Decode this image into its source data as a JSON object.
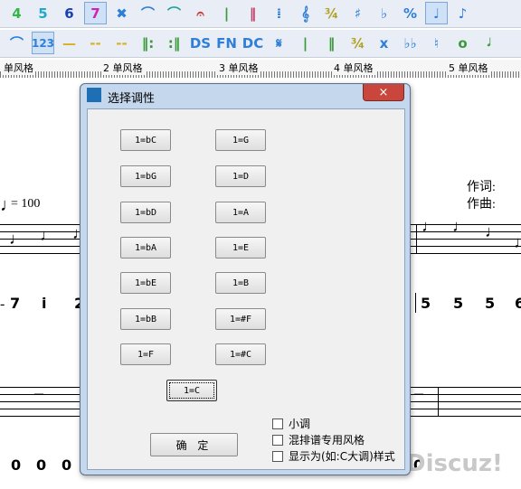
{
  "toolbar_row1": [
    {
      "icon": "digit-4-icon",
      "glyph": "4",
      "color": "#36b54a"
    },
    {
      "icon": "digit-5-icon",
      "glyph": "5",
      "color": "#22a9c9"
    },
    {
      "icon": "digit-6-icon",
      "glyph": "6",
      "color": "#1a3fb0"
    },
    {
      "icon": "digit-7-icon",
      "glyph": "7",
      "color": "#d21fb4",
      "active": true
    },
    {
      "icon": "cross-icon",
      "glyph": "✖",
      "color": "#2f7fd8"
    },
    {
      "icon": "slur-icon",
      "glyph": "⌒",
      "color": "#2f7fd8"
    },
    {
      "icon": "tie-icon",
      "glyph": "⌒",
      "color": "#1fa0a0"
    },
    {
      "icon": "fermata-icon",
      "glyph": "𝄐",
      "color": "#d03a3a"
    },
    {
      "icon": "bar-single-icon",
      "glyph": "|",
      "color": "#3a9a3a"
    },
    {
      "icon": "bar-double-icon",
      "glyph": "‖",
      "color": "#c0406e"
    },
    {
      "icon": "repeat-bar-icon",
      "glyph": "⁞",
      "color": "#2f7fd8"
    },
    {
      "icon": "treble-clef-icon",
      "glyph": "𝄞",
      "color": "#2f7fd8"
    },
    {
      "icon": "time-signature-icon",
      "glyph": "¾",
      "color": "#b0a020"
    },
    {
      "icon": "sharp-icon",
      "glyph": "♯",
      "color": "#2f7fd8"
    },
    {
      "icon": "flat-icon",
      "glyph": "♭",
      "color": "#2f7fd8"
    },
    {
      "icon": "percent-icon",
      "glyph": "%",
      "color": "#2f7fd8"
    },
    {
      "icon": "quarter-note-icon",
      "glyph": "♩",
      "color": "#2f7fd8",
      "active": true
    },
    {
      "icon": "eighth-note-icon",
      "glyph": "♪",
      "color": "#2f7fd8"
    }
  ],
  "toolbar_row2": [
    {
      "icon": "slur-up-icon",
      "glyph": "⌒",
      "color": "#2f7fd8"
    },
    {
      "icon": "numbering-icon",
      "glyph": "123",
      "color": "#2f7fd8",
      "active": true
    },
    {
      "icon": "dash-icon",
      "glyph": "—",
      "color": "#d9b020"
    },
    {
      "icon": "dash-dash-icon",
      "glyph": "--",
      "color": "#d9b020"
    },
    {
      "icon": "dotted-dash-icon",
      "glyph": "--",
      "color": "#d9b020"
    },
    {
      "icon": "repeat-start-icon",
      "glyph": "‖:",
      "color": "#3a9a3a"
    },
    {
      "icon": "repeat-end-icon",
      "glyph": ":‖",
      "color": "#3a9a3a"
    },
    {
      "icon": "ds-icon",
      "glyph": "DS",
      "color": "#2f7fd8"
    },
    {
      "icon": "fine-icon",
      "glyph": "FN",
      "color": "#2f7fd8"
    },
    {
      "icon": "dc-icon",
      "glyph": "DC",
      "color": "#2f7fd8"
    },
    {
      "icon": "segno-icon",
      "glyph": "𝄋",
      "color": "#2f7fd8"
    },
    {
      "icon": "bar-line-icon",
      "glyph": "|",
      "color": "#3a9a3a"
    },
    {
      "icon": "final-bar-icon",
      "glyph": "‖",
      "color": "#3a9a3a"
    },
    {
      "icon": "time-signature-2-icon",
      "glyph": "¾",
      "color": "#b0a020"
    },
    {
      "icon": "double-sharp-icon",
      "glyph": "x",
      "color": "#2f7fd8"
    },
    {
      "icon": "double-flat-icon",
      "glyph": "♭♭",
      "color": "#2f7fd8"
    },
    {
      "icon": "natural-icon",
      "glyph": "♮",
      "color": "#2f7fd8"
    },
    {
      "icon": "whole-note-icon",
      "glyph": "o",
      "color": "#3a9a3a"
    },
    {
      "icon": "half-note-icon",
      "glyph": "𝅗𝅥",
      "color": "#3a9a3a"
    }
  ],
  "ruler_labels": [
    "单风格",
    "2 单风格",
    "3 单风格",
    "4 单风格",
    "5 单风格"
  ],
  "score": {
    "tempo": "= 100",
    "lyricist": "作词:",
    "composer": "作曲:",
    "numbers_left": [
      "7",
      "i",
      "2"
    ],
    "numbers_right": [
      "5",
      "5",
      "5",
      "6"
    ],
    "rest_left": "–",
    "rest_right": "–",
    "bottom_numbers": [
      "0",
      "0",
      "0",
      "0"
    ]
  },
  "dialog": {
    "title": "选择调性",
    "close_label": "×",
    "keys_left": [
      "1=bC",
      "1=bG",
      "1=bD",
      "1=bA",
      "1=bE",
      "1=bB",
      "1=F"
    ],
    "keys_right": [
      "1=G",
      "1=D",
      "1=A",
      "1=E",
      "1=B",
      "1=#F",
      "1=#C"
    ],
    "key_center": "1=C",
    "ok_label": "确 定",
    "checkboxes": [
      "小调",
      "混排谱专用风格",
      "显示为(如:C大调)样式"
    ]
  },
  "watermark": "Discuz!"
}
